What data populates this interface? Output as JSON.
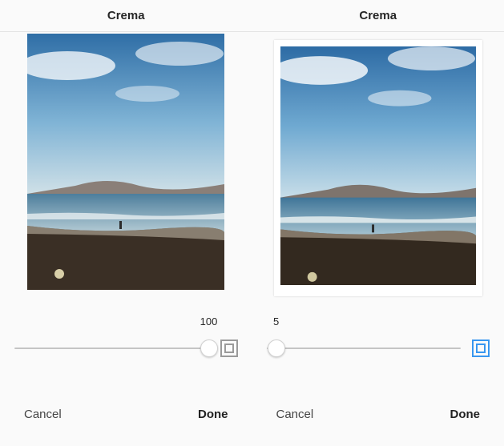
{
  "panels": [
    {
      "filter_name": "Crema",
      "slider_value": 100,
      "slider_min": 0,
      "slider_max": 100,
      "frame_enabled": false,
      "cancel_label": "Cancel",
      "done_label": "Done"
    },
    {
      "filter_name": "Crema",
      "slider_value": 5,
      "slider_min": 0,
      "slider_max": 100,
      "frame_enabled": true,
      "cancel_label": "Cancel",
      "done_label": "Done"
    }
  ]
}
